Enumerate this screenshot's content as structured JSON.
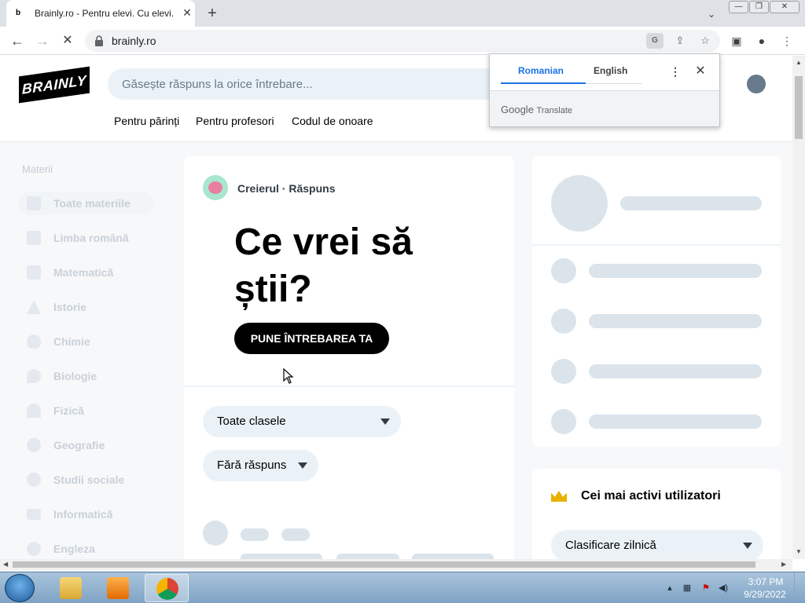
{
  "browser": {
    "tab_favicon": "b",
    "tab_title": "Brainly.ro - Pentru elevi. Cu elevi.",
    "tab_close": "✕",
    "new_tab": "+",
    "tab_search": "⌄",
    "win_min": "—",
    "win_max": "❐",
    "win_close": "✕",
    "url": "brainly.ro",
    "back": "←",
    "forward": "→",
    "stop": "✕"
  },
  "page": {
    "logo": "BRAINLY",
    "search_placeholder": "Găsește răspuns la orice întrebare...",
    "nav": [
      "Pentru părinți",
      "Pentru profesori",
      "Codul de onoare"
    ],
    "sidebar_title": "Materii",
    "subjects": [
      "Toate materiile",
      "Limba română",
      "Matematică",
      "Istorie",
      "Chimie",
      "Biologie",
      "Fizică",
      "Geografie",
      "Studii sociale",
      "Informatică",
      "Engleza"
    ],
    "creierul": "Creierul · Răspuns",
    "hero": "Ce vrei să știi?",
    "ask_button": "PUNE ÎNTREBAREA TA",
    "filter_class": "Toate clasele",
    "filter_answer": "Fără răspuns",
    "active_users_title": "Cei mai activi utilizatori",
    "ranking_select": "Clasificare zilnică"
  },
  "translate_popup": {
    "source_lang": "Romanian",
    "target_lang": "English",
    "menu": "⋮",
    "close": "✕",
    "google": "Google",
    "translate": "Translate"
  },
  "taskbar": {
    "time": "3:07 PM",
    "date": "9/29/2022"
  },
  "colors": {
    "accent": "#1a73e8",
    "skeleton": "#dbe4eb",
    "brand": "#000000"
  }
}
